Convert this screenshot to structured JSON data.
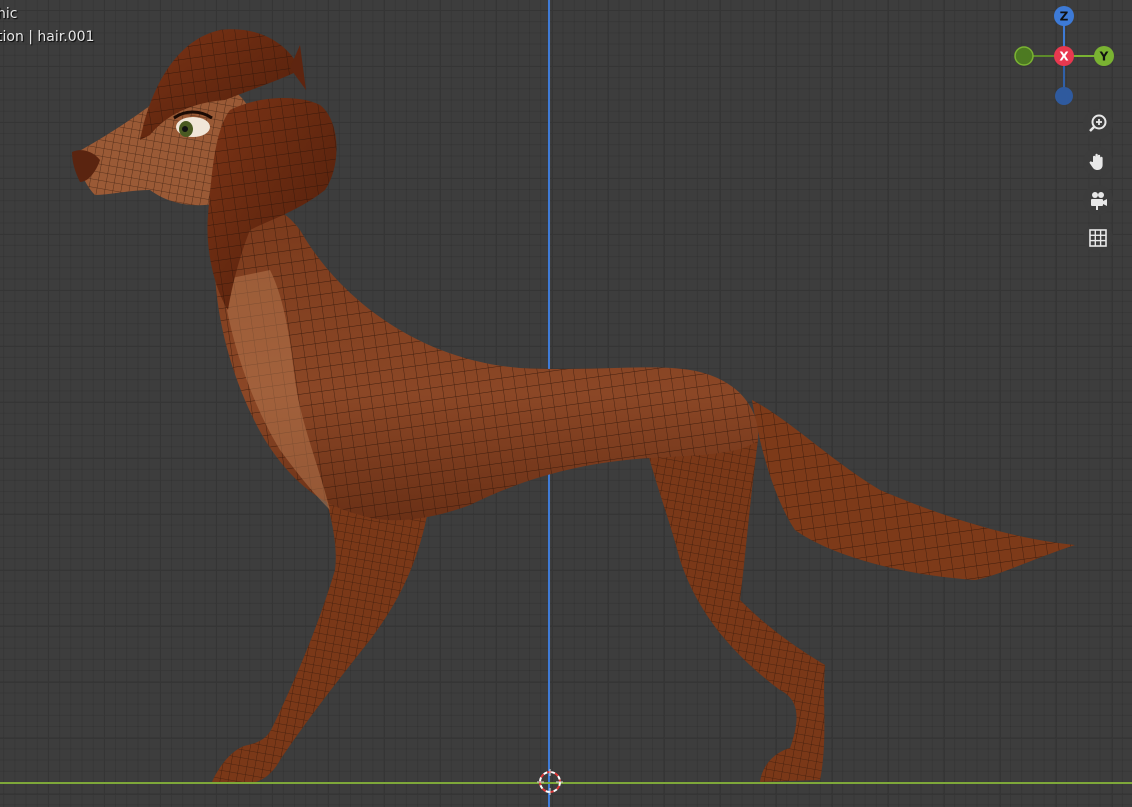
{
  "viewport": {
    "view_name": "hic",
    "object_info": "tion | hair.001",
    "grid_color": "#3d3d3d"
  },
  "gizmo": {
    "z_label": "Z",
    "x_label": "X",
    "y_label": "Y",
    "z_color": "#3d7ad6",
    "x_color": "#e8384f",
    "y_color": "#7ab332"
  },
  "tools": [
    {
      "icon": "zoom-icon"
    },
    {
      "icon": "hand-icon"
    },
    {
      "icon": "camera-icon"
    },
    {
      "icon": "grid-icon"
    }
  ],
  "model": {
    "color": "#8a4524"
  }
}
